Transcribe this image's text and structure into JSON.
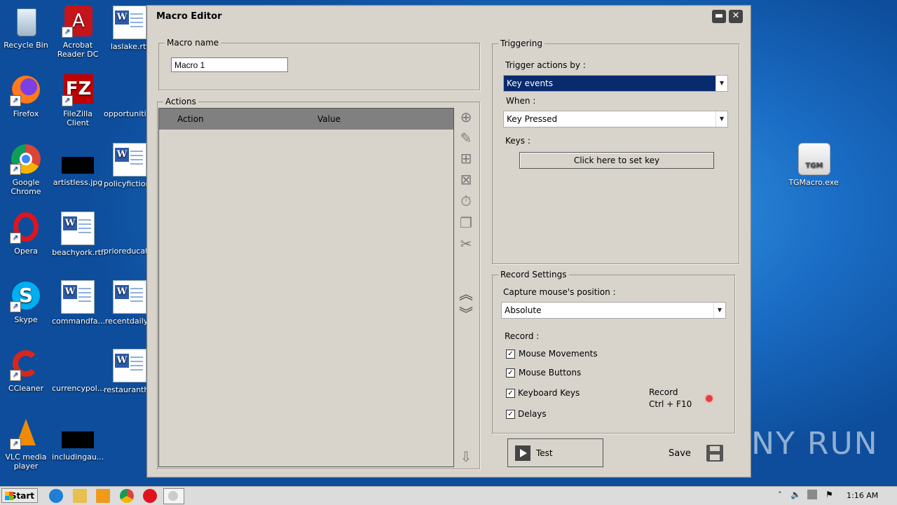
{
  "desktop": {
    "icons": [
      {
        "label": "Recycle Bin"
      },
      {
        "label": "Acrobat Reader DC"
      },
      {
        "label": "laslake.rtf"
      },
      {
        "label": "Firefox"
      },
      {
        "label": "FileZilla Client"
      },
      {
        "label": "opportunitie..."
      },
      {
        "label": "Google Chrome"
      },
      {
        "label": "artistless.jpg"
      },
      {
        "label": "policyfiction..."
      },
      {
        "label": "Opera"
      },
      {
        "label": "beachyork.rtf"
      },
      {
        "label": "prioreducati..."
      },
      {
        "label": "Skype"
      },
      {
        "label": "commandfa..."
      },
      {
        "label": "recentdaily..."
      },
      {
        "label": "CCleaner"
      },
      {
        "label": "currencypol..."
      },
      {
        "label": "restauranth..."
      },
      {
        "label": "VLC media player"
      },
      {
        "label": "includingau..."
      },
      {
        "label": "TGMacro.exe"
      }
    ],
    "watermark": "ANY RUN"
  },
  "window": {
    "title": "Macro Editor",
    "minimize_label": "▬",
    "close_label": "✕",
    "macro_name": {
      "legend": "Macro name",
      "value": "Macro 1"
    },
    "actions": {
      "legend": "Actions",
      "columns": [
        "Action",
        "Value"
      ]
    },
    "triggering": {
      "legend": "Triggering",
      "trigger_label": "Trigger actions by :",
      "trigger_value": "Key events",
      "when_label": "When :",
      "when_value": "Key Pressed",
      "keys_label": "Keys :",
      "set_key_button": "Click here to set key"
    },
    "record_settings": {
      "legend": "Record Settings",
      "capture_label": "Capture mouse's position :",
      "capture_value": "Absolute",
      "record_label": "Record :",
      "options": [
        {
          "label": "Mouse Movements",
          "checked": true
        },
        {
          "label": "Mouse Buttons",
          "checked": true
        },
        {
          "label": "Keyboard Keys",
          "checked": true
        },
        {
          "label": "Delays",
          "checked": true
        }
      ],
      "record_hotkey_line1": "Record",
      "record_hotkey_line2": "Ctrl + F10"
    },
    "test_button": "Test",
    "save_label": "Save"
  },
  "taskbar": {
    "start_label": "Start",
    "time": "1:16 AM"
  }
}
